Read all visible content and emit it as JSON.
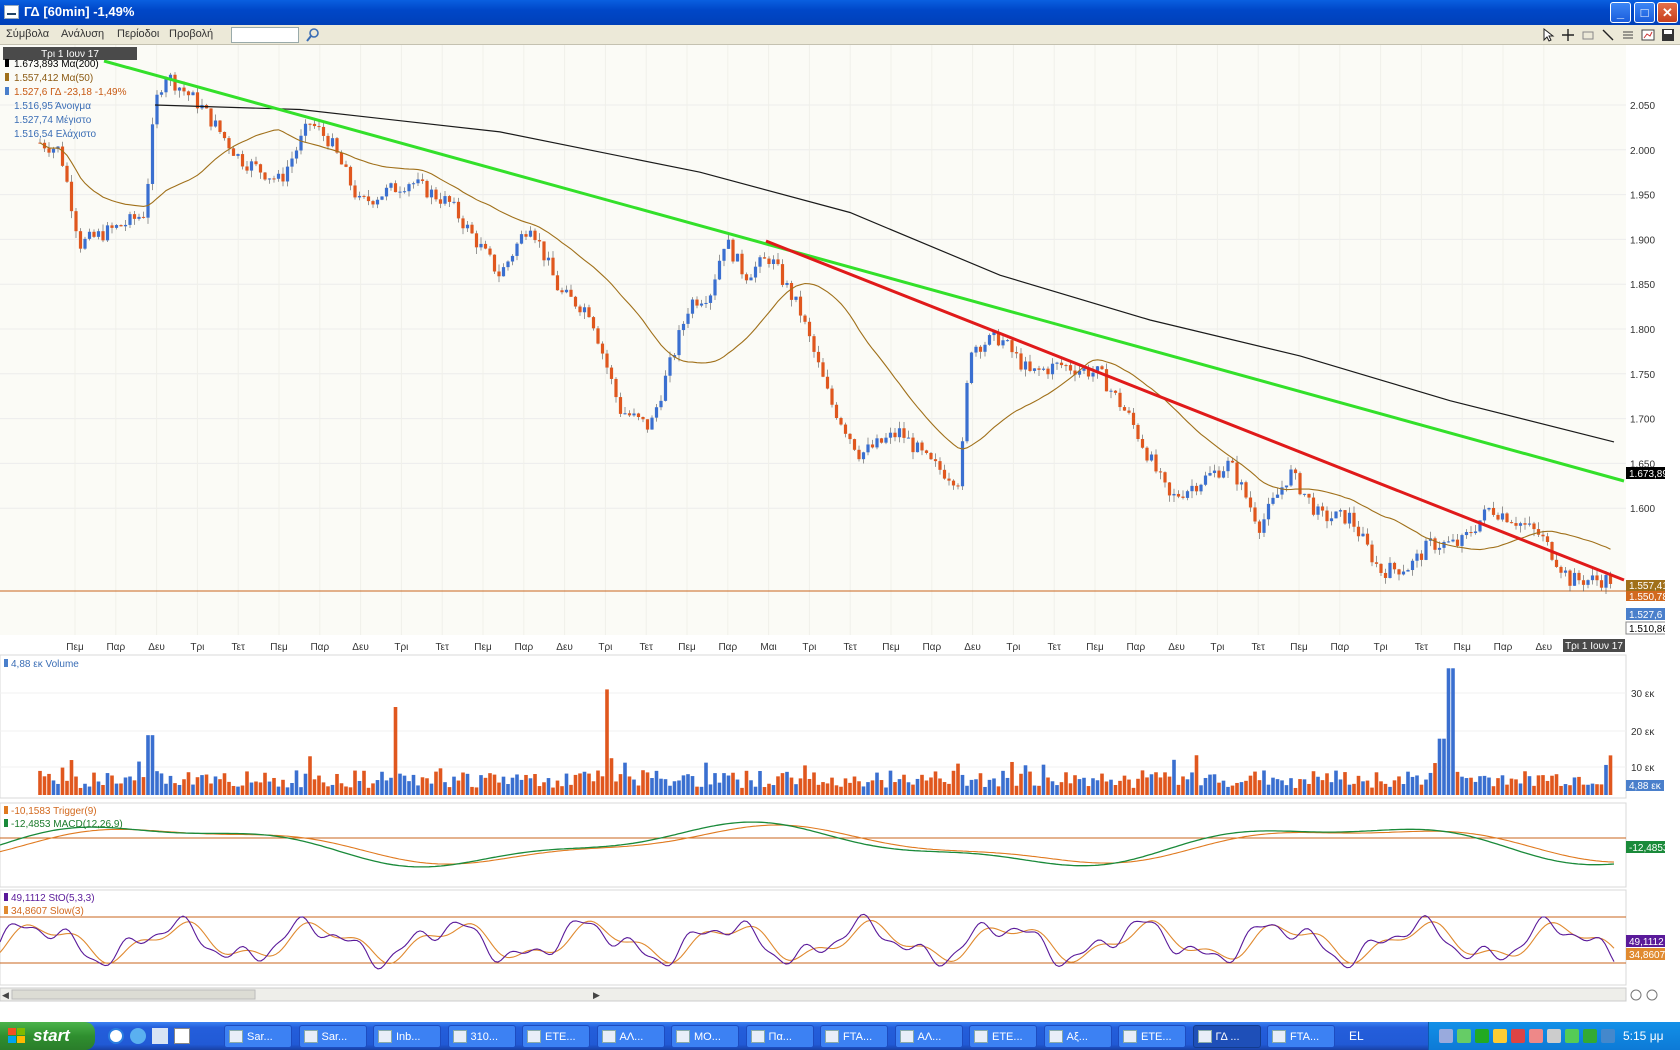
{
  "window": {
    "title": "ΓΔ [60min] -1,49%"
  },
  "menu": [
    "Σύμβολα",
    "Ανάλυση",
    "Περίοδοι",
    "Προβολή"
  ],
  "search": {
    "value": ""
  },
  "price_panel": {
    "date_header": "Τρι 1 Ιουν 17",
    "legend": [
      {
        "text": "1.673,893 Μα(200)",
        "color": "#000000"
      },
      {
        "text": "1.557,412 Μα(50)",
        "color": "#8b5a12"
      },
      {
        "text": "1.527,6 ΓΔ -23,18 -1,49%",
        "color": "#c85a14"
      },
      {
        "text": "1.516,95 Άνοιγμα",
        "color": "#3a6db5"
      },
      {
        "text": "1.527,74 Μέγιστο",
        "color": "#3a6db5"
      },
      {
        "text": "1.516,54 Ελάχιστο",
        "color": "#3a6db5"
      }
    ],
    "y_ticks": [
      "2.050",
      "2.000",
      "1.950",
      "1.900",
      "1.850",
      "1.800",
      "1.750",
      "1.700",
      "1.650",
      "1.600"
    ],
    "badges": [
      {
        "text": "1.673,893",
        "bg": "#000000",
        "fg": "#ffffff"
      },
      {
        "text": "1.557,412",
        "bg": "#a0701a",
        "fg": "#ffffff"
      },
      {
        "text": "1.550,78",
        "bg": "#d2691e",
        "fg": "#ffffff"
      },
      {
        "text": "1.527,6",
        "bg": "#4a7fcb",
        "fg": "#ffffff"
      },
      {
        "text": "1.510,868",
        "bg": "#ffffff",
        "fg": "#000000"
      }
    ],
    "x_labels": [
      "Πεμ",
      "Παρ",
      "Δευ",
      "Τρι",
      "Τετ",
      "Πεμ",
      "Παρ",
      "Δευ",
      "Τρι",
      "Τετ",
      "Πεμ",
      "Παρ",
      "Δευ",
      "Τρι",
      "Τετ",
      "Πεμ",
      "Παρ",
      "Μαι",
      "Τρι",
      "Τετ",
      "Πεμ",
      "Παρ",
      "Δευ",
      "Τρι",
      "Τετ",
      "Πεμ",
      "Παρ",
      "Δευ",
      "Τρι",
      "Τετ",
      "Πεμ",
      "Παρ",
      "Τρι",
      "Τετ",
      "Πεμ",
      "Παρ",
      "Δευ"
    ],
    "x_label_current": "Τρι 1 Ιουν 17"
  },
  "volume_panel": {
    "legend": "4,88 εκ Volume",
    "y_ticks": [
      "30 εκ",
      "20 εκ",
      "10 εκ"
    ],
    "badge": "4,88 εκ"
  },
  "macd_panel": {
    "legend": [
      {
        "text": "-10,1583 Trigger(9)",
        "color": "#d2691e"
      },
      {
        "text": "-12,4853 MACD(12,26,9)",
        "color": "#1a7a2a"
      }
    ],
    "badge": "-12,4853"
  },
  "sto_panel": {
    "legend": [
      {
        "text": "49,1112 StO(5,3,3)",
        "color": "#5a1a9a"
      },
      {
        "text": "34,8607 Slow(3)",
        "color": "#d2691e"
      }
    ],
    "badges": [
      {
        "text": "49,1112",
        "bg": "#5a1a9a"
      },
      {
        "text": "34,8607",
        "bg": "#e08a30"
      }
    ]
  },
  "colors": {
    "up": "#3a6fd0",
    "down": "#e0571e",
    "ma200": "#1a1a1a",
    "ma50": "#a0701a",
    "green_trend": "#33e02a",
    "red_trend": "#e01a1a"
  },
  "chart_data": {
    "type": "candlestick",
    "title": "ΓΔ [60min]",
    "ylim": [
      1500,
      2080
    ],
    "trendlines": [
      {
        "color": "green",
        "from": 2095,
        "to": 1665
      },
      {
        "color": "red",
        "from": 1900,
        "to": 1555
      }
    ],
    "moving_averages": [
      {
        "name": "Μα(200)",
        "last": 1673.893
      },
      {
        "name": "Μα(50)",
        "last": 1557.412
      }
    ],
    "last": {
      "close": 1527.6,
      "open": 1516.95,
      "high": 1527.74,
      "low": 1516.54,
      "change": -23.18,
      "change_pct": -1.49
    }
  },
  "taskbar": {
    "start_label": "start",
    "tasks": [
      "Sar...",
      "Sar...",
      "Inb...",
      "310...",
      "ETE...",
      "AΛ...",
      "MO...",
      "Πα...",
      "FTA...",
      "AΛ...",
      "ETE...",
      "Αξ...",
      "ETE...",
      "ΓΔ ...",
      "FTA..."
    ],
    "active_index": 13,
    "language": "EL",
    "clock": "5:15 μμ"
  }
}
